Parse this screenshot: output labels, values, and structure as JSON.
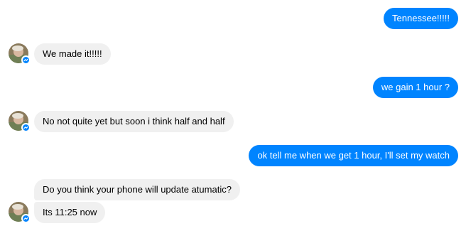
{
  "colors": {
    "outgoing_bubble": "#0084ff",
    "incoming_bubble": "#f0f0f0",
    "messenger_badge": "#0084ff"
  },
  "messages": [
    {
      "sender": "me",
      "text": "Tennessee!!!!!"
    },
    {
      "sender": "contact",
      "text": "We made it!!!!!"
    },
    {
      "sender": "me",
      "text": "we gain 1 hour ?"
    },
    {
      "sender": "contact",
      "text": "No not quite yet but soon i think half and half"
    },
    {
      "sender": "me",
      "text": "ok tell me when we get 1 hour, I'll set my watch"
    },
    {
      "sender": "contact",
      "text": "Do you think your phone will update atumatic?"
    },
    {
      "sender": "contact",
      "text": "Its 11:25 now"
    }
  ]
}
